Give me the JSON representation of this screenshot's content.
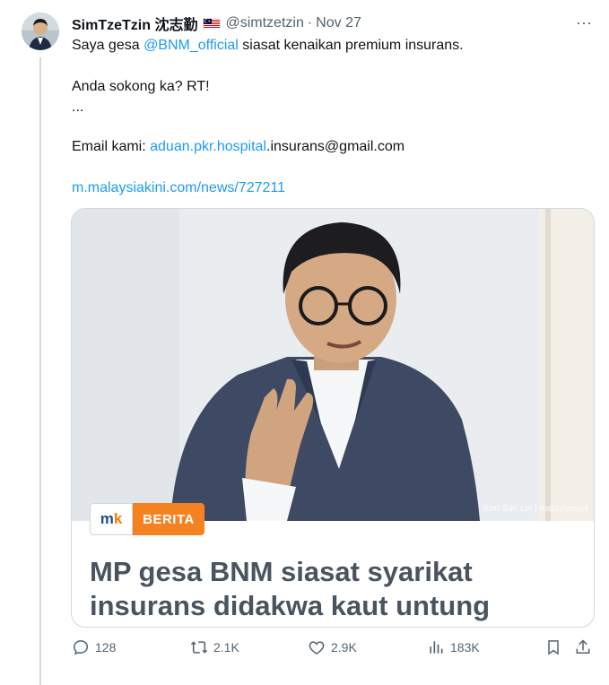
{
  "tweet": {
    "author_name": "SimTzeTzin 沈志勤",
    "handle": "@simtzetzin",
    "separator": "·",
    "date": "Nov 27",
    "more_glyph": "···",
    "line1_prefix": "Saya gesa ",
    "line1_mention": "@BNM_official",
    "line1_suffix": " siasat kenaikan premium insurans.",
    "line2": "Anda sokong ka? RT!",
    "line3": "...",
    "email_label": "Email kami:  ",
    "email_link": "aduan.pkr.hospital",
    "email_rest": ".insurans@gmail.com",
    "url": "m.malaysiakini.com/news/727211"
  },
  "card": {
    "photo_credit": "Kon Sun Lin | malaysiakini",
    "logo_m": "m",
    "logo_k": "k",
    "badge": "BERITA",
    "headline": "MP gesa BNM siasat syarikat insurans didakwa kaut untung melampau"
  },
  "actions": {
    "replies": "128",
    "reposts": "2.1K",
    "likes": "2.9K",
    "views": "183K"
  },
  "colors": {
    "accent": "#1d9bf0",
    "muted": "#536471",
    "badge": "#f58220"
  },
  "icons": [
    "reply-icon",
    "repost-icon",
    "like-icon",
    "views-icon",
    "bookmark-icon",
    "share-icon",
    "more-icon"
  ]
}
